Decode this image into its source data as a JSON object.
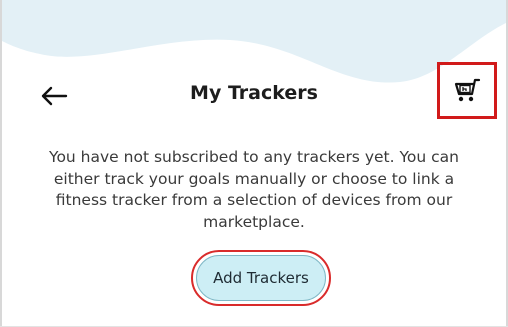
{
  "header": {
    "title": "My Trackers",
    "back_icon": "arrow-left-icon",
    "cart_icon": "shopping-cart-icon"
  },
  "main": {
    "message": "You have not subscribed to any trackers yet. You can either track your goals manually or choose to link a fitness tracker from a selection of devices from our marketplace.",
    "add_button_label": "Add Trackers"
  },
  "colors": {
    "wave": "#e3f0f6",
    "button_fill": "#cdeef5",
    "highlight": "#d11a1a"
  }
}
